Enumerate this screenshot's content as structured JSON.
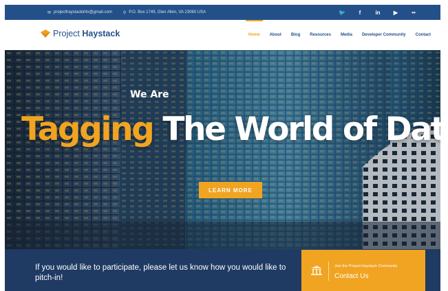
{
  "topbar": {
    "email": "projecthaystackinfo@gmail.com",
    "address": "P.O. Box 1749, Glen Allen, VA 23060 USA",
    "email_icon": "mail-icon",
    "address_icon": "map-pin-icon",
    "social": [
      {
        "name": "twitter-icon",
        "glyph": "🐦"
      },
      {
        "name": "facebook-icon",
        "glyph": "f"
      },
      {
        "name": "linkedin-icon",
        "glyph": "in"
      },
      {
        "name": "youtube-icon",
        "glyph": "▶"
      },
      {
        "name": "flickr-icon",
        "glyph": "••"
      }
    ]
  },
  "nav": {
    "logo_light": "Project",
    "logo_bold": "Haystack",
    "items": [
      "Home",
      "About",
      "Blog",
      "Resources",
      "Media",
      "Developer Community",
      "Contact"
    ],
    "active": "Home"
  },
  "hero": {
    "kicker": "We Are",
    "headline_accent": "Tagging",
    "headline_rest": " The World of Data",
    "button_label": "LEARN MORE"
  },
  "band": {
    "message": "If you would like to participate, please let us know how you would like to pitch-in!",
    "cta_small": "Join the Project Haystack Community",
    "cta_big": "Contact Us",
    "cta_icon": "institution-icon"
  },
  "colors": {
    "primary": "#24508a",
    "accent": "#f0a422",
    "band": "#1f3a63"
  }
}
